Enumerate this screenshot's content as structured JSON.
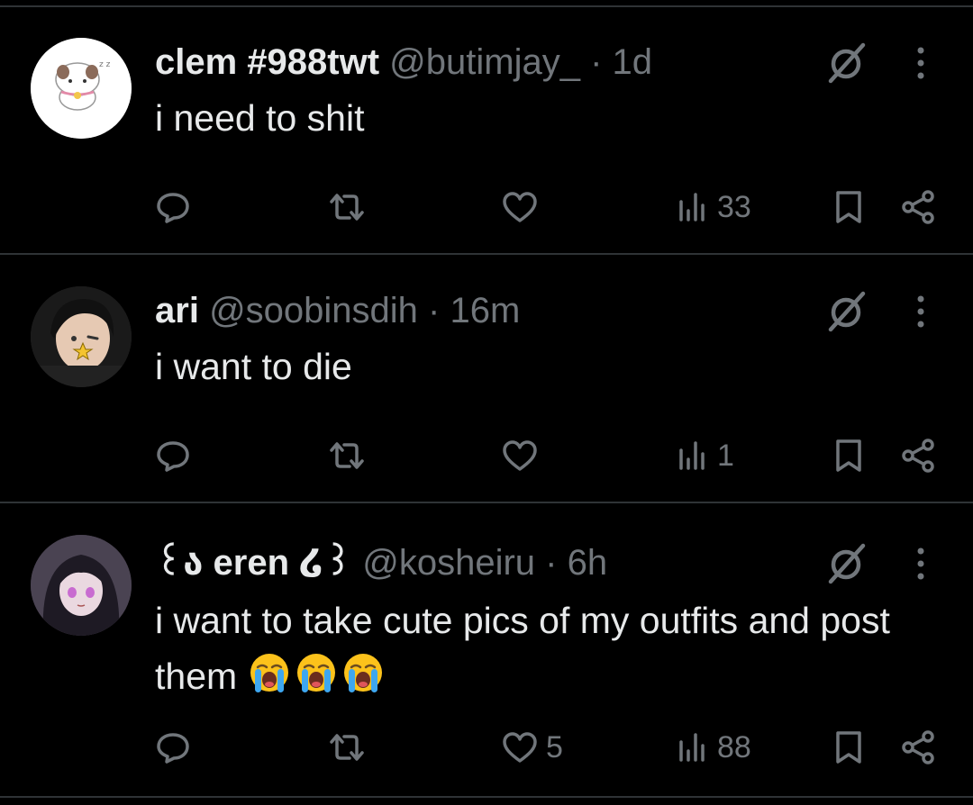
{
  "tweets": [
    {
      "name": "clem #988twt",
      "handle": "@butimjay_",
      "dot": "·",
      "time": "1d",
      "text": "i need to shit",
      "emoji_count": 0,
      "replies": "",
      "retweets": "",
      "likes": "",
      "views": "33"
    },
    {
      "name": "ari",
      "handle": "@soobinsdih",
      "dot": "·",
      "time": "16m",
      "text": "i want to die",
      "emoji_count": 0,
      "replies": "",
      "retweets": "",
      "likes": "",
      "views": "1"
    },
    {
      "name": "꒰ა eren ໒꒱",
      "handle": "@kosheiru",
      "dot": "·",
      "time": "6h",
      "text": "i want to take cute pics of my outfits and post them",
      "emoji": "😭",
      "emoji_count": 3,
      "replies": "",
      "retweets": "",
      "likes": "5",
      "views": "88"
    }
  ],
  "icons": {
    "reply": "reply-icon",
    "retweet": "retweet-icon",
    "like": "heart-icon",
    "views": "views-icon",
    "bookmark": "bookmark-icon",
    "share": "share-icon",
    "grok": "grok-icon",
    "more": "more-icon"
  },
  "colors": {
    "background": "#000000",
    "text": "#e7e9ea",
    "muted": "#71767b",
    "divider": "#2f3336"
  }
}
